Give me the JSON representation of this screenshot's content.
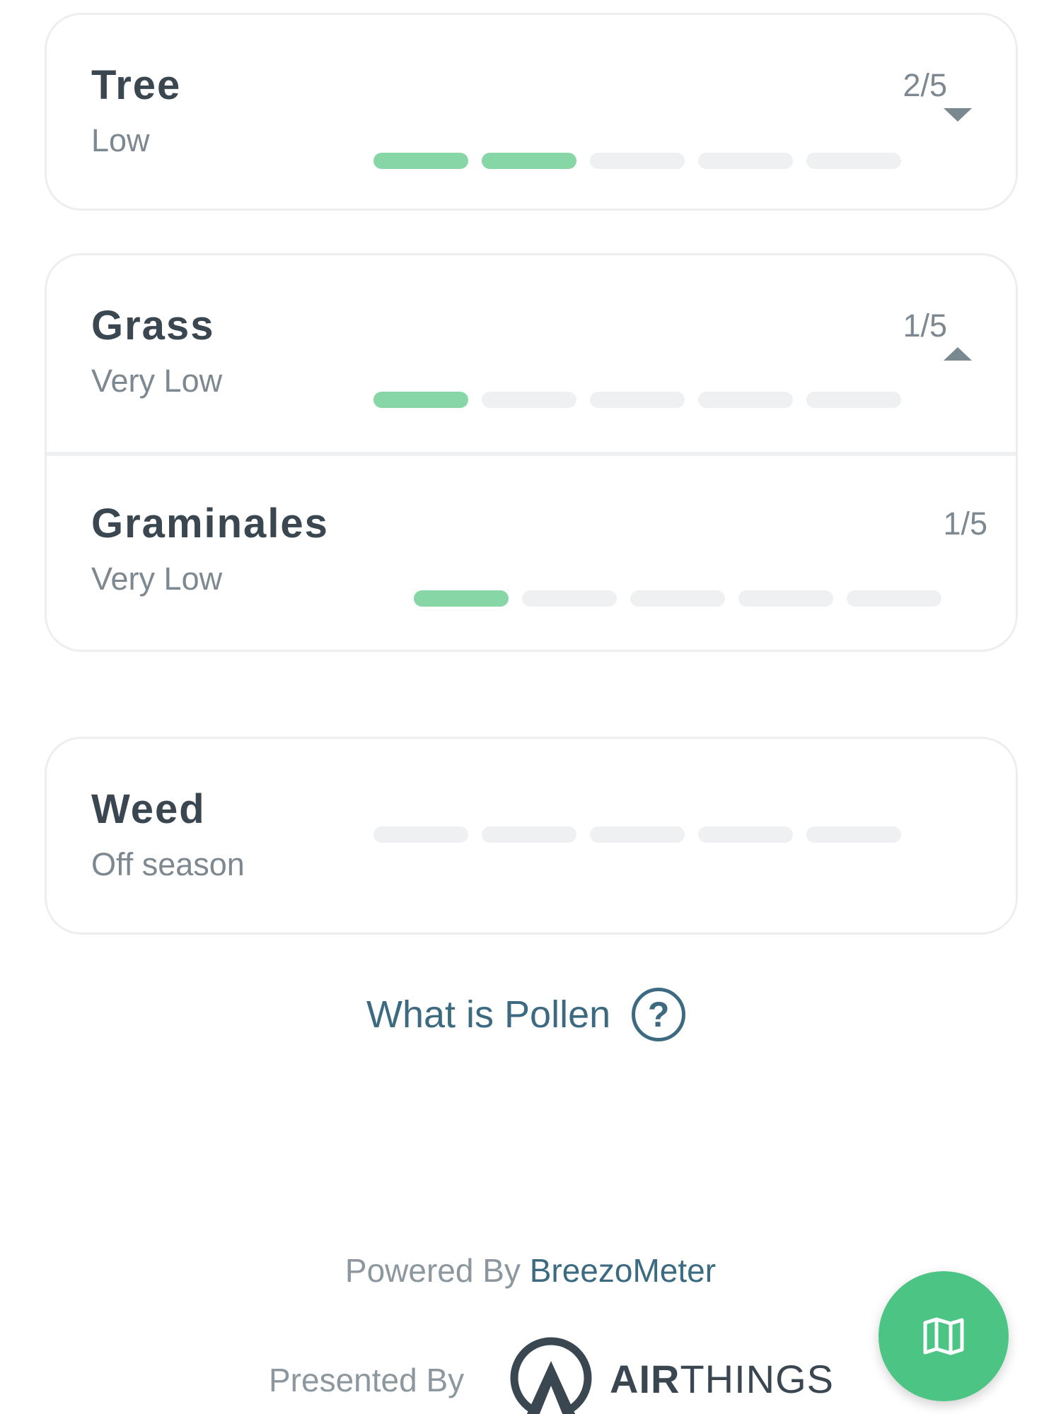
{
  "categories": [
    {
      "title": "Tree",
      "level": "Low",
      "score_text": "2/5",
      "score": 2,
      "max": 5,
      "expanded": false
    },
    {
      "title": "Grass",
      "level": "Very Low",
      "score_text": "1/5",
      "score": 1,
      "max": 5,
      "expanded": true,
      "subtypes": [
        {
          "title": "Graminales",
          "level": "Very Low",
          "score_text": "1/5",
          "score": 1,
          "max": 5
        }
      ]
    },
    {
      "title": "Weed",
      "level": "Off season",
      "score_text": "",
      "score": 0,
      "max": 5,
      "expanded": false
    }
  ],
  "help": {
    "label": "What is Pollen",
    "icon": "question-circle-icon"
  },
  "footer": {
    "powered_prefix": "Powered By",
    "powered_brand": "BreezoMeter",
    "presented_prefix": "Presented By",
    "presenter_bold": "AIR",
    "presenter_rest": "THINGS"
  },
  "fab": {
    "icon": "map-icon"
  },
  "colors": {
    "active_segment": "#86d7a5",
    "inactive_segment": "#eef0f1",
    "link": "#3c6a80",
    "fab": "#4cc483"
  }
}
